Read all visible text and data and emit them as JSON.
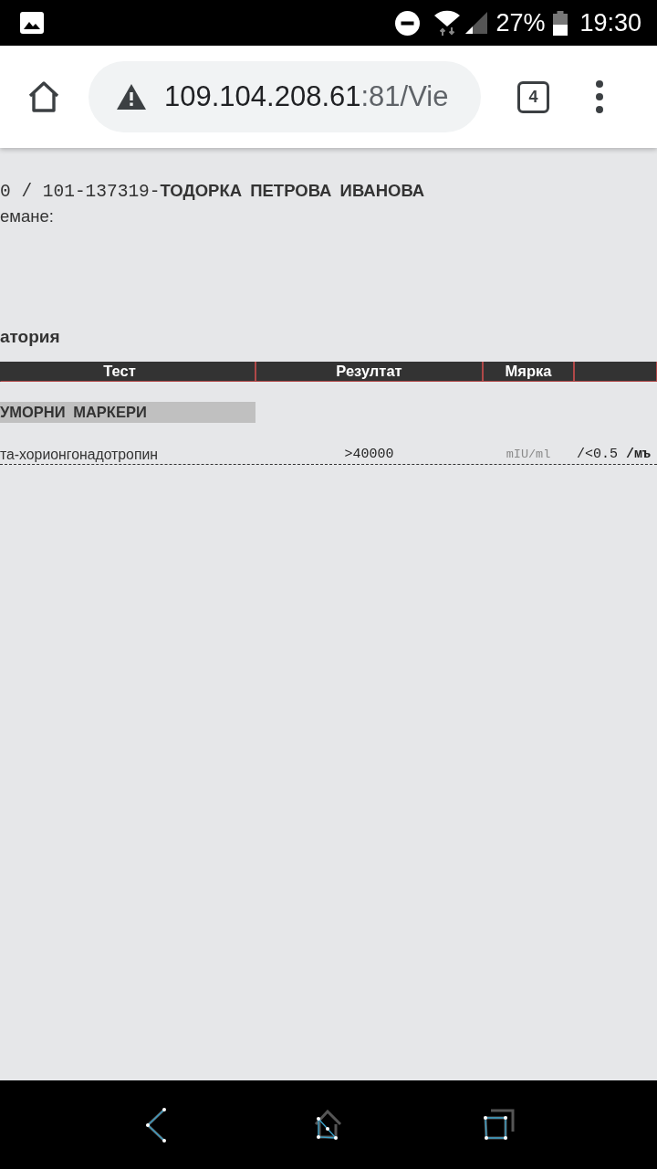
{
  "status_bar": {
    "battery": "27%",
    "time": "19:30"
  },
  "browser": {
    "url_host": "109.104.208.61",
    "url_rest": ":81/Vie",
    "tab_count": "4"
  },
  "page": {
    "record_number": "0 / 101-137319-",
    "patient_name": "ТОДОРКА ПЕТРОВА ИВАНОВА",
    "sample_label": "емане:",
    "section_title": "атория"
  },
  "table": {
    "columns": [
      "Тест",
      "Резултат",
      "Мярка"
    ],
    "groups": [
      {
        "title": "УМОРНИ МАРКЕРИ",
        "rows": [
          {
            "test": "та-хорионгонадотропин",
            "result": ">40000",
            "unit": "mIU/ml",
            "reference": "/<0.5 **/мъ**"
          }
        ]
      }
    ]
  }
}
